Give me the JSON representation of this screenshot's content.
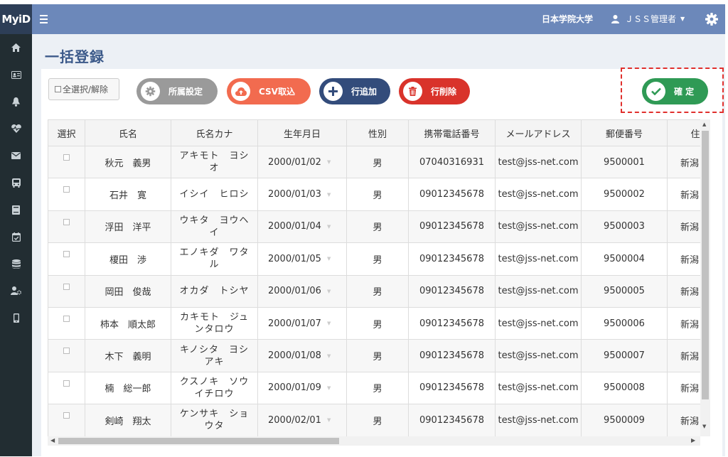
{
  "app": {
    "logo": "MyiD",
    "university": "日本学院大学",
    "user": "ＪＳＳ管理者"
  },
  "page": {
    "title": "一括登録"
  },
  "toolbar": {
    "select_all": "全選択/解除",
    "affiliation": "所属設定",
    "csv_import": "CSV取込",
    "add_row": "行追加",
    "delete_row": "行削除",
    "confirm": "確 定"
  },
  "colors": {
    "header": "#6c88ba",
    "sidebar": "#222d32",
    "confirm": "#2f9a55",
    "csv": "#f26b4f",
    "add": "#334c7b",
    "delete": "#d9332b",
    "highlight": "#e0302d"
  },
  "sidebar": {
    "icons": [
      "home-icon",
      "id-card-icon",
      "bell-icon",
      "heartbeat-icon",
      "envelope-icon",
      "bus-icon",
      "book-icon",
      "calendar-check-icon",
      "database-icon",
      "user-settings-icon",
      "mobile-icon"
    ]
  },
  "table": {
    "columns": [
      "選択",
      "氏名",
      "氏名カナ",
      "生年月日",
      "性別",
      "携帯電話番号",
      "メールアドレス",
      "郵便番号",
      "住"
    ],
    "rows": [
      {
        "name": "秋元　義男",
        "kana": "アキモト　ヨシオ",
        "dob": "2000/01/02",
        "gender": "男",
        "phone": "07040316931",
        "email": "test@jss-net.com",
        "zip": "9500001",
        "pref": "新潟"
      },
      {
        "name": "石井　寛",
        "kana": "イシイ　ヒロシ",
        "dob": "2000/01/03",
        "gender": "男",
        "phone": "09012345678",
        "email": "test@jss-net.com",
        "zip": "9500002",
        "pref": "新潟"
      },
      {
        "name": "浮田　洋平",
        "kana": "ウキタ　ヨウヘイ",
        "dob": "2000/01/04",
        "gender": "男",
        "phone": "09012345678",
        "email": "test@jss-net.com",
        "zip": "9500003",
        "pref": "新潟"
      },
      {
        "name": "榎田　渉",
        "kana": "エノキダ　ワタル",
        "dob": "2000/01/05",
        "gender": "男",
        "phone": "09012345678",
        "email": "test@jss-net.com",
        "zip": "9500004",
        "pref": "新潟"
      },
      {
        "name": "岡田　俊哉",
        "kana": "オカダ　トシヤ",
        "dob": "2000/01/06",
        "gender": "男",
        "phone": "09012345678",
        "email": "test@jss-net.com",
        "zip": "9500005",
        "pref": "新潟"
      },
      {
        "name": "柿本　順太郎",
        "kana": "カキモト　ジュンタロウ",
        "dob": "2000/01/07",
        "gender": "男",
        "phone": "09012345678",
        "email": "test@jss-net.com",
        "zip": "9500006",
        "pref": "新潟"
      },
      {
        "name": "木下　義明",
        "kana": "キノシタ　ヨシアキ",
        "dob": "2000/01/08",
        "gender": "男",
        "phone": "09012345678",
        "email": "test@jss-net.com",
        "zip": "9500007",
        "pref": "新潟"
      },
      {
        "name": "楠　総一郎",
        "kana": "クスノキ　ソウイチロウ",
        "dob": "2000/01/09",
        "gender": "男",
        "phone": "09012345678",
        "email": "test@jss-net.com",
        "zip": "9500008",
        "pref": "新潟"
      },
      {
        "name": "剣崎　翔太",
        "kana": "ケンサキ　ショウタ",
        "dob": "2000/02/01",
        "gender": "男",
        "phone": "09012345678",
        "email": "test@jss-net.com",
        "zip": "9500009",
        "pref": "新潟"
      }
    ]
  }
}
